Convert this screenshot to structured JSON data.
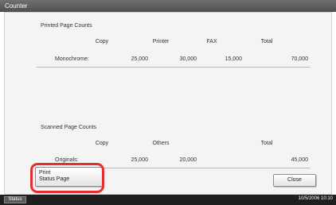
{
  "window": {
    "title": "Counter"
  },
  "printed": {
    "title": "Printed Page Counts",
    "columns": [
      "Copy",
      "Printer",
      "FAX",
      "Total"
    ],
    "row": {
      "label": "Monochrome:",
      "values": [
        "25,000",
        "30,000",
        "15,000",
        "70,000"
      ]
    }
  },
  "scanned": {
    "title": "Scanned Page Counts",
    "columns": [
      "Copy",
      "Others",
      "Total"
    ],
    "row": {
      "label": "Originals:",
      "values": [
        "25,000",
        "20,000",
        "45,000"
      ]
    }
  },
  "buttons": {
    "print_status_line1": "Print",
    "print_status_line2": "Status Page",
    "close": "Close"
  },
  "statusbar": {
    "status_label": "Status",
    "datetime": "10/5/2006  10:10"
  },
  "colors": {
    "highlight": "#e23030",
    "titlebar": "#5e5f5f"
  }
}
